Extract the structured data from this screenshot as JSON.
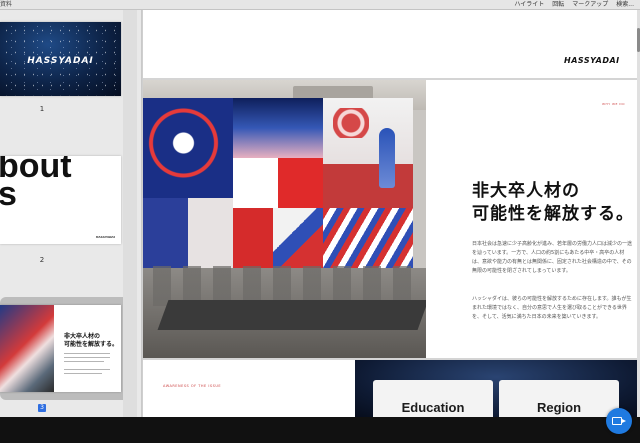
{
  "toolbar": {
    "doc_title": "資料",
    "menu": [
      "ハイライト",
      "回転",
      "マークアップ",
      "検索..."
    ]
  },
  "sidebar": {
    "thumbs": [
      {
        "number": "1",
        "logo": "HASSYADAI"
      },
      {
        "number": "2",
        "big_text": "bout\ns",
        "brand": "HASSYADAI"
      },
      {
        "number": "3",
        "title": "非大卒人材の\n可能性を解放する。"
      }
    ],
    "selected_badge": "3"
  },
  "main": {
    "page_top_logo": "HASSYADAI",
    "why_label": "WHY WE DO",
    "heading": "非大卒人材の\n可能性を解放する。",
    "paragraph1": "日本社会は急速に少子高齢化が進み、若年層の労働力人口は減少の一途を辿っています。一方で、人口の約5割にもあたる中卒・高卒の人材は、意欲や能力の有無とは無関係に、固定された社会構造の中で、その無限の可能性を閉ざされてしまっています。",
    "paragraph2": "ハッシャダイは、彼らの可能性を解放するために存在します。誰もが生まれた環境ではなく、自分の意思で人生を選び取ることができる世界を、そして、活気に満ちた日本の未来を築いていきます。",
    "awareness_label": "AWARENESS OF THE ISSUE",
    "cards": [
      "Education",
      "Region"
    ]
  },
  "colors": {
    "accent_red": "#c44444",
    "fab_blue": "#1f7ae0",
    "selection_blue": "#2f6ee0"
  },
  "icons": {
    "fab": "video-camera-icon"
  }
}
